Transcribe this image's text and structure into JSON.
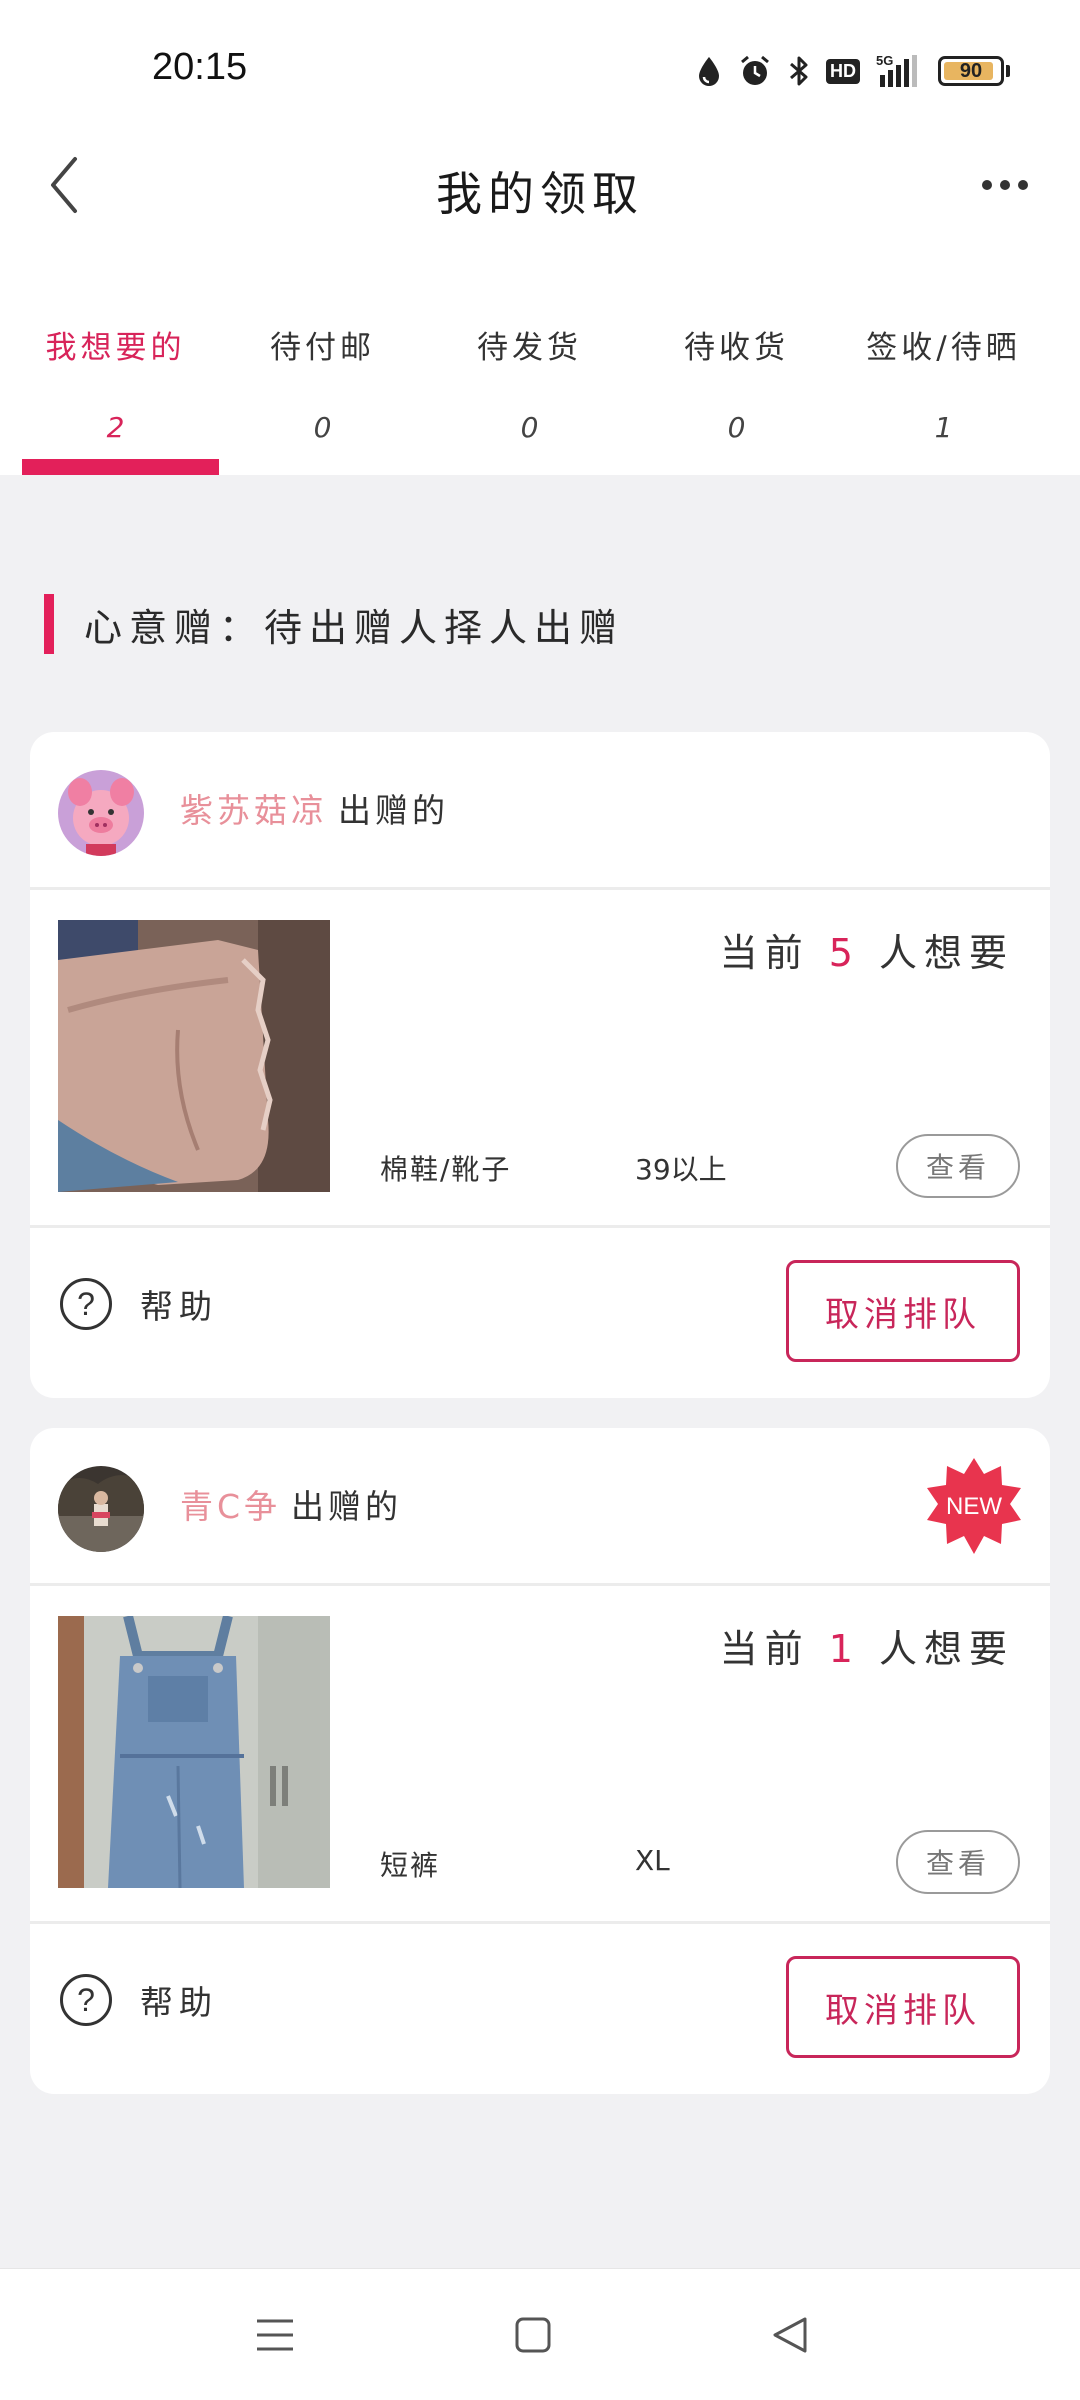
{
  "status_bar": {
    "time": "20:15",
    "hd_label": "HD",
    "battery_level": "90",
    "battery_fraction": 0.9,
    "icons": [
      "water-drop-icon",
      "alarm-icon",
      "bluetooth-icon",
      "hd-icon",
      "signal-5g-icon",
      "battery-icon"
    ]
  },
  "header": {
    "title": "我的领取",
    "back_icon": "chevron-left-icon",
    "more_icon": "more-dots-icon"
  },
  "tabs": [
    {
      "label": "我想要的",
      "count": "2",
      "active": true
    },
    {
      "label": "待付邮",
      "count": "0",
      "active": false
    },
    {
      "label": "待发货",
      "count": "0",
      "active": false
    },
    {
      "label": "待收货",
      "count": "0",
      "active": false
    },
    {
      "label": "签收/待晒",
      "count": "1",
      "active": false
    }
  ],
  "section": {
    "title": "心意赠：待出赠人择人出赠"
  },
  "cards": [
    {
      "giver_name": "紫苏菇凉",
      "giver_suffix": "出赠的",
      "wanting_prefix": "当前",
      "wanting_count": "5",
      "wanting_suffix": "人想要",
      "category": "棉鞋/靴子",
      "size": "39以上",
      "view_label": "查看",
      "help_label": "帮助",
      "cancel_label": "取消排队",
      "is_new": false
    },
    {
      "giver_name": "青C争",
      "giver_suffix": "出赠的",
      "wanting_prefix": "当前",
      "wanting_count": "1",
      "wanting_suffix": "人想要",
      "category": "短裤",
      "size": "XL",
      "view_label": "查看",
      "help_label": "帮助",
      "cancel_label": "取消排队",
      "is_new": true,
      "new_badge": "NEW"
    }
  ],
  "nav_bar": {
    "icons": [
      "menu-icon",
      "home-square-icon",
      "back-triangle-icon"
    ]
  },
  "colors": {
    "accent": "#e3205a",
    "giver_name": "#e8909a",
    "background": "#f1f1f3",
    "new_badge": "#e8344e"
  }
}
